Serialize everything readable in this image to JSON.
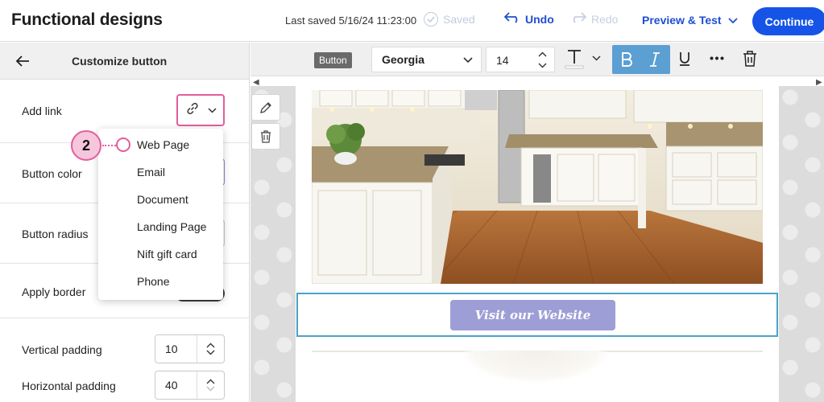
{
  "header": {
    "title": "Functional designs",
    "last_saved": "Last saved 5/16/24 11:23:00",
    "saved_label": "Saved",
    "undo_label": "Undo",
    "redo_label": "Redo",
    "preview_label": "Preview & Test",
    "continue_label": "Continue"
  },
  "panel": {
    "title": "Customize button",
    "add_link_label": "Add link",
    "button_color_label": "Button color",
    "button_radius_label": "Button radius",
    "apply_border_label": "Apply border",
    "vertical_padding_label": "Vertical padding",
    "vertical_padding_value": "10",
    "horizontal_padding_label": "Horizontal padding",
    "horizontal_padding_value": "40"
  },
  "link_menu": {
    "items": [
      "Web Page",
      "Email",
      "Document",
      "Landing Page",
      "Nift gift card",
      "Phone"
    ],
    "step_marker": "2"
  },
  "toolbar": {
    "element_tag": "Button",
    "font_family": "Georgia",
    "font_size": "14"
  },
  "canvas": {
    "button_text": "Visit our Website"
  },
  "colors": {
    "accent_blue": "#1654e8",
    "highlight_pink": "#e35d9d",
    "button_fill": "#9e9ed6",
    "selection_border": "#4aa3c7"
  }
}
